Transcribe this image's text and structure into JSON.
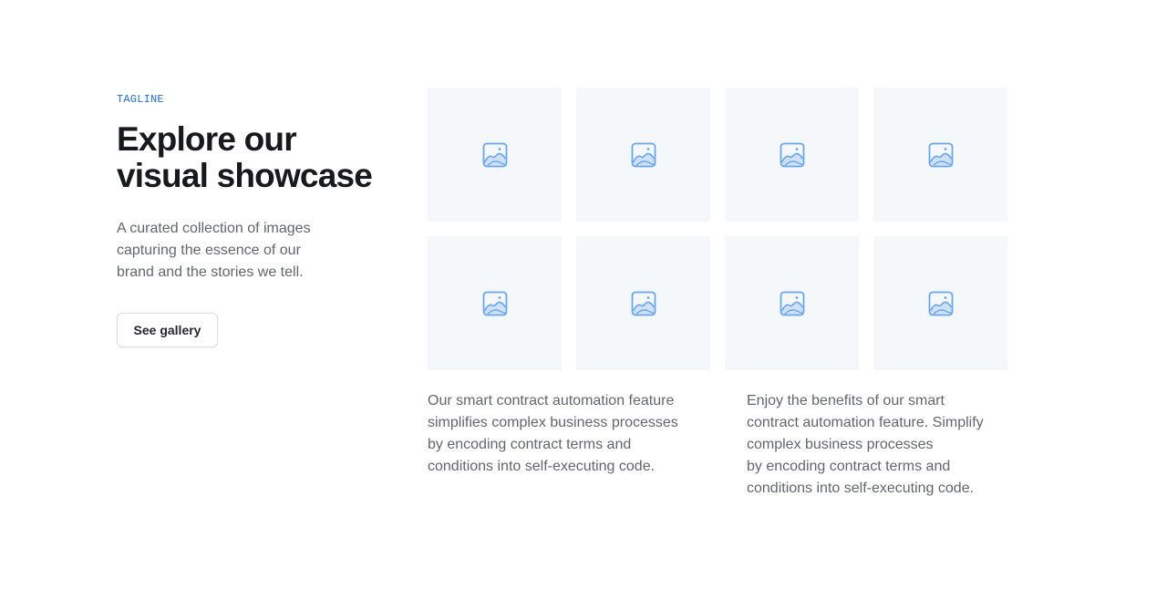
{
  "hero": {
    "tagline": "TAGLINE",
    "heading_lines": [
      "Explore our",
      "visual showcase"
    ],
    "lede_lines": [
      "A curated collection of images",
      "capturing the essence of our",
      "brand and the stories we tell."
    ],
    "button_label": "See gallery"
  },
  "gallery": {
    "tiles": [
      {
        "icon": "image-placeholder-icon"
      },
      {
        "icon": "image-placeholder-icon"
      },
      {
        "icon": "image-placeholder-icon"
      },
      {
        "icon": "image-placeholder-icon"
      },
      {
        "icon": "image-placeholder-icon"
      },
      {
        "icon": "image-placeholder-icon"
      },
      {
        "icon": "image-placeholder-icon"
      },
      {
        "icon": "image-placeholder-icon"
      }
    ]
  },
  "features": [
    {
      "lines": [
        "Our smart contract automation feature",
        "simplifies complex business processes",
        "by encoding contract terms and",
        "conditions into self-executing code."
      ]
    },
    {
      "lines": [
        "Enjoy the benefits of our smart",
        "contract automation feature. Simplify",
        "complex business processes",
        "by encoding contract terms and",
        "conditions into self-executing code."
      ]
    }
  ],
  "colors": {
    "accent": "#1f6fd6",
    "heading": "#18191c",
    "body_text": "#63666f",
    "tile_background": "#f5f8fb",
    "icon": "#6aa6ef"
  }
}
